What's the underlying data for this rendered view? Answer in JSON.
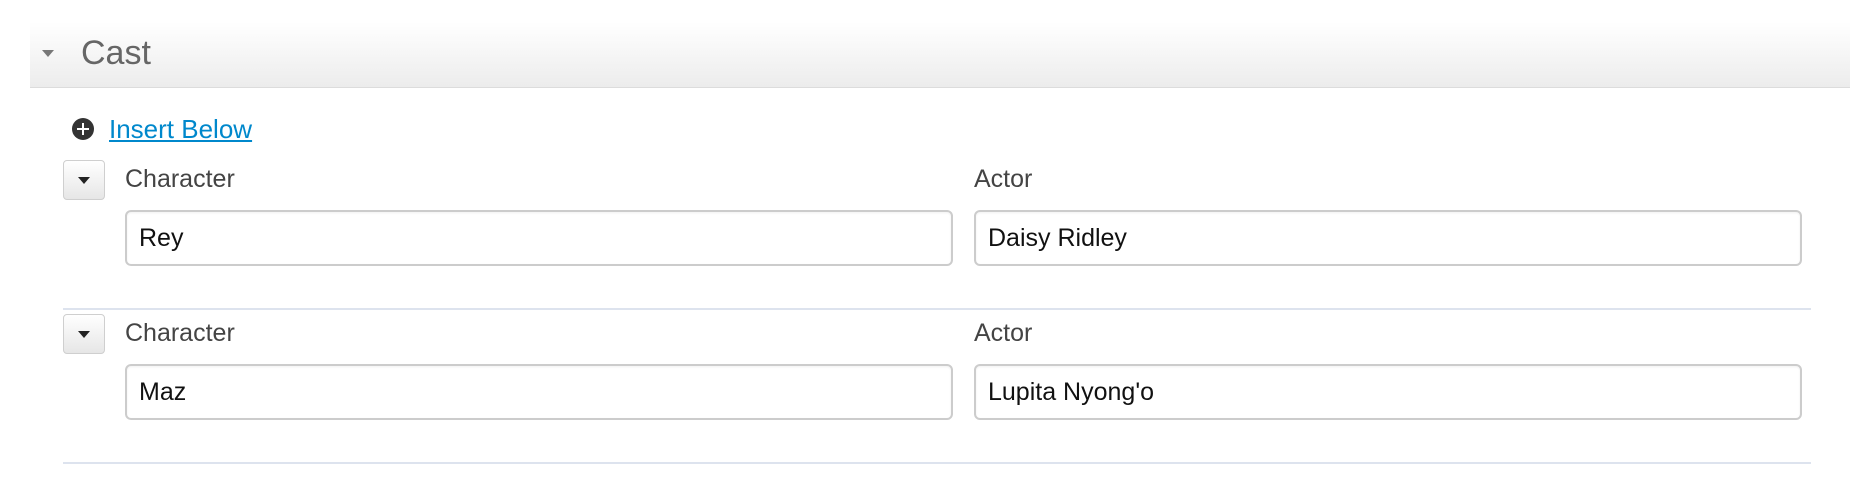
{
  "section": {
    "title": "Cast"
  },
  "insert": {
    "label": "Insert Below"
  },
  "rows": [
    {
      "character_label": "Character",
      "actor_label": "Actor",
      "character": "Rey",
      "actor": "Daisy Ridley"
    },
    {
      "character_label": "Character",
      "actor_label": "Actor",
      "character": "Maz",
      "actor": "Lupita Nyong'o"
    }
  ],
  "icons": {
    "section_toggle": "caret-down-icon",
    "insert": "plus-circle-icon",
    "row_toggle": "caret-down-icon"
  }
}
